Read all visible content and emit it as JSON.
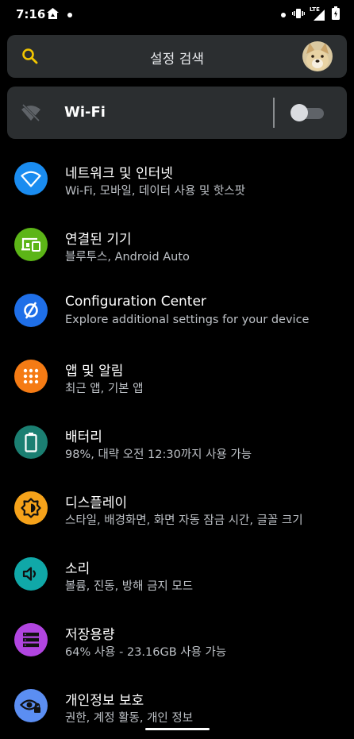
{
  "status_bar": {
    "time": "7:16",
    "network_label": "LTE"
  },
  "search": {
    "label": "설정 검색"
  },
  "wifi": {
    "label": "Wi-Fi",
    "enabled": false
  },
  "settings": [
    {
      "title": "네트워크 및 인터넷",
      "subtitle": "Wi-Fi, 모바일, 데이터 사용 및 핫스팟",
      "icon": "wifi-icon",
      "color": "#1a8cf0"
    },
    {
      "title": "연결된 기기",
      "subtitle": "블루투스, Android Auto",
      "icon": "devices-icon",
      "color": "#5cb517"
    },
    {
      "title": "Configuration Center",
      "subtitle": "Explore additional settings for your device",
      "icon": "circle-slash-icon",
      "color": "#1f6fe8"
    },
    {
      "title": "앱 및 알림",
      "subtitle": "최근 앱, 기본 앱",
      "icon": "apps-grid-icon",
      "color": "#f57b14"
    },
    {
      "title": "배터리",
      "subtitle": "98%, 대략 오전 12:30까지 사용 가능",
      "icon": "battery-icon",
      "color": "#1b7f72"
    },
    {
      "title": "디스플레이",
      "subtitle": "스타일, 배경화면, 화면 자동 잠금 시간, 글꼴 크기",
      "icon": "brightness-icon",
      "color": "#f5a21a"
    },
    {
      "title": "소리",
      "subtitle": "볼륨, 진동, 방해 금지 모드",
      "icon": "volume-icon",
      "color": "#10a8a8"
    },
    {
      "title": "저장용량",
      "subtitle": "64% 사용 - 23.16GB 사용 가능",
      "icon": "storage-icon",
      "color": "#b145e0"
    },
    {
      "title": "개인정보 보호",
      "subtitle": "권한, 계정 활동, 개인 정보",
      "icon": "privacy-eye-icon",
      "color": "#5b8ef2"
    }
  ]
}
